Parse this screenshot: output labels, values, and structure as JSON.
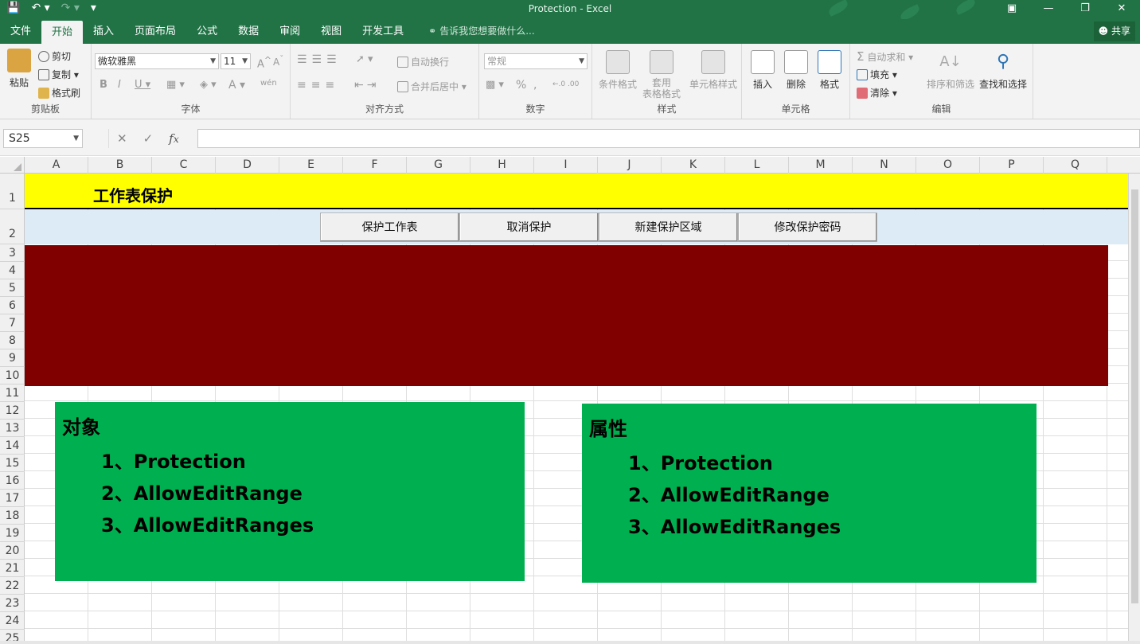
{
  "window": {
    "title": "Protection - Excel"
  },
  "qat": {
    "save_icon": "save-icon",
    "undo_icon": "undo-icon",
    "redo_icon": "redo-icon",
    "customize_icon": "customize-icon"
  },
  "menu": {
    "tabs": [
      "文件",
      "开始",
      "插入",
      "页面布局",
      "公式",
      "数据",
      "审阅",
      "视图",
      "开发工具"
    ],
    "active": "开始",
    "tellme": "告诉我您想要做什么...",
    "share": "共享"
  },
  "ribbon": {
    "clipboard": {
      "label": "剪贴板",
      "paste": "粘贴",
      "cut": "剪切",
      "copy": "复制",
      "format_painter": "格式刷"
    },
    "font": {
      "label": "字体",
      "name": "微软雅黑",
      "size": "11"
    },
    "alignment": {
      "label": "对齐方式",
      "wrap": "自动换行",
      "merge": "合并后居中"
    },
    "number": {
      "label": "数字",
      "format": "常规"
    },
    "styles": {
      "label": "样式",
      "conditional": "条件格式",
      "table": "套用\n表格格式",
      "table_a": "套用",
      "table_b": "表格格式",
      "cell_styles": "单元格样式"
    },
    "cells": {
      "label": "单元格",
      "insert": "插入",
      "delete": "删除",
      "format": "格式"
    },
    "editing": {
      "label": "编辑",
      "autosum": "自动求和",
      "fill": "填充",
      "clear": "清除",
      "sort": "排序和筛选",
      "find": "查找和选择"
    }
  },
  "formula": {
    "namebox": "S25",
    "value": ""
  },
  "sheet": {
    "columns": [
      "A",
      "B",
      "C",
      "D",
      "E",
      "F",
      "G",
      "H",
      "I",
      "J",
      "K",
      "L",
      "M",
      "N",
      "O",
      "P",
      "Q"
    ],
    "rows": [
      "1",
      "2",
      "3",
      "4",
      "5",
      "6",
      "7",
      "8",
      "9",
      "10",
      "11",
      "12",
      "13",
      "14",
      "15",
      "16",
      "17",
      "18",
      "19",
      "20",
      "21",
      "22",
      "23",
      "24",
      "25"
    ],
    "title": "工作表保护",
    "buttons": [
      "保护工作表",
      "取消保护",
      "新建保护区域",
      "修改保护密码"
    ],
    "objects": {
      "heading": "对象",
      "items": [
        "1、Protection",
        "2、AllowEditRange",
        "3、AllowEditRanges"
      ]
    },
    "properties": {
      "heading": "属性",
      "items": [
        "1、Protection",
        "2、AllowEditRange",
        "3、AllowEditRanges"
      ]
    },
    "colors": {
      "title_fill": "#ffff00",
      "button_band": "#ddebf7",
      "block": "#800000",
      "box": "#00b050"
    }
  }
}
